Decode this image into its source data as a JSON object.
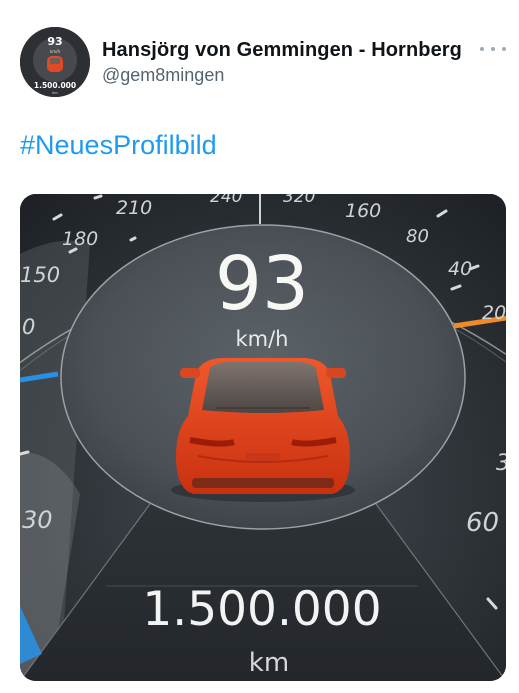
{
  "author": {
    "display_name": "Hansjörg von Gemmingen - Hornberg",
    "handle": "@gem8mingen",
    "avatar": {
      "speed": "93",
      "unit": "km/h",
      "odometer": "1.500.000",
      "odometer_unit": "km"
    }
  },
  "more_icon": "more-horizontal-icon",
  "tweet": {
    "text": "#NeuesProfilbild"
  },
  "media": {
    "speed": "93",
    "speed_unit": "km/h",
    "odometer": "1.500.000",
    "odometer_unit": "km",
    "scale_labels": {
      "s210": "210",
      "s180": "180",
      "s150": "150",
      "s0": "0",
      "s30": "30",
      "s240": "240",
      "s320": "320",
      "s160": "160",
      "s80": "80",
      "s40": "40",
      "s20": "20",
      "s3": "3",
      "s60": "60"
    },
    "colors": {
      "car": "#e8401c",
      "blue_marker": "#2a8fe0",
      "orange_marker": "#f08a28"
    }
  }
}
